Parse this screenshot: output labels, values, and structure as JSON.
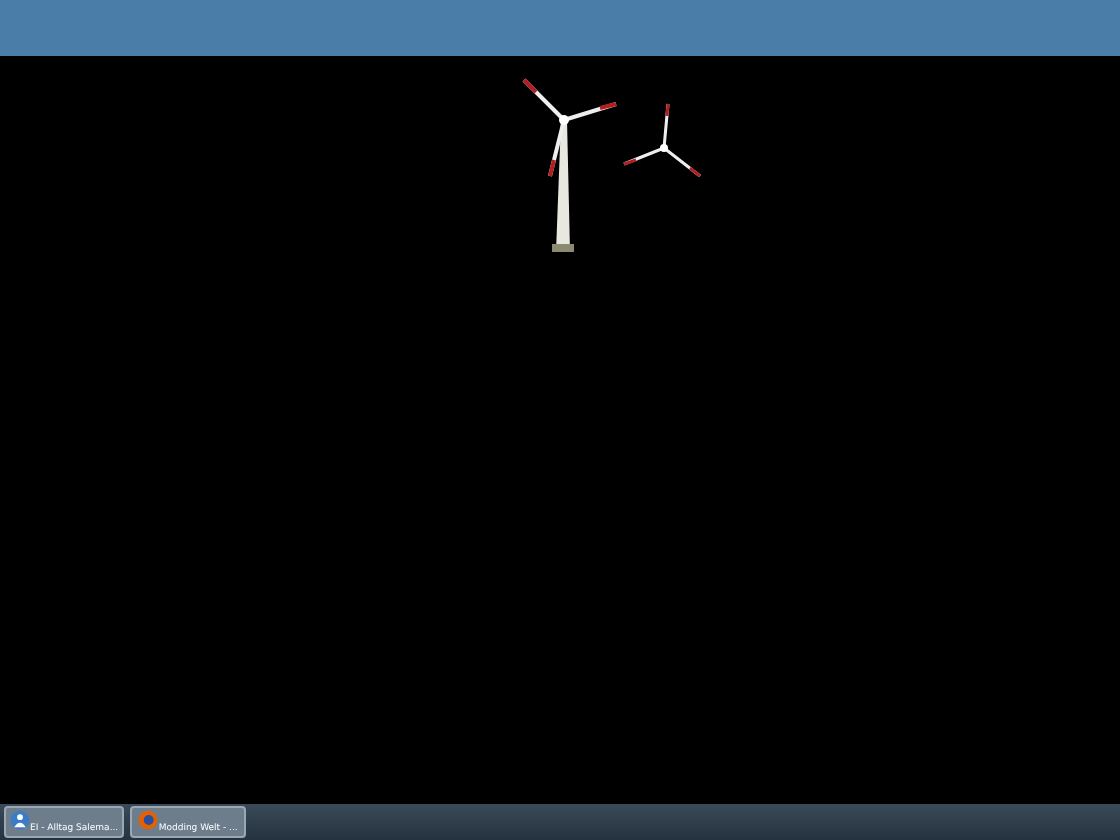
{
  "taskbar": {
    "items": [
      {
        "label": "EI - Alltag Salema..."
      },
      {
        "label": "Modding Welt - ..."
      }
    ]
  }
}
